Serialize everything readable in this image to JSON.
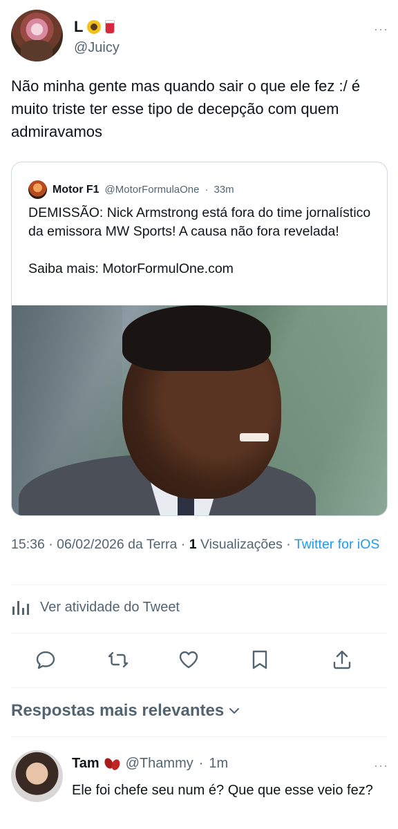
{
  "tweet": {
    "author_name": "L",
    "author_emoji": "🌻🥤",
    "author_handle": "@Juicy",
    "more": "···",
    "text": "Não minha gente mas quando sair o que ele fez :/ é muito triste ter esse tipo de decepção com quem admiravamos"
  },
  "quoted": {
    "name": "Motor F1",
    "handle": "@MotorFormulaOne",
    "separator": "·",
    "time": "33m",
    "text": "DEMISSÃO: Nick Armstrong está fora do time jornalístico da emissora MW Sports! A causa não fora revelada!\n\nSaiba mais: MotorFormulOne.com"
  },
  "meta": {
    "time": "15:36",
    "date": "06/02/2026 da Terra",
    "views_count": "1",
    "views_label": "Visualizações",
    "source": "Twitter for iOS"
  },
  "activity": {
    "icon": "bar-chart-icon",
    "label": "Ver atividade do Tweet"
  },
  "actions": [
    "reply-icon",
    "retweet-icon",
    "like-icon",
    "bookmark-icon",
    "share-icon"
  ],
  "replies_section": {
    "title": "Respostas mais relevantes"
  },
  "reply": {
    "name": "Tam",
    "emoji": "🫘",
    "handle": "@Thammy",
    "separator": "·",
    "time": "1m",
    "more": "···",
    "text": "Ele foi chefe seu num é? Que que esse veio fez?"
  },
  "colors": {
    "text": "#0f1419",
    "secondary": "#536471",
    "link": "#1d9bf0",
    "border": "#cfd9de"
  }
}
